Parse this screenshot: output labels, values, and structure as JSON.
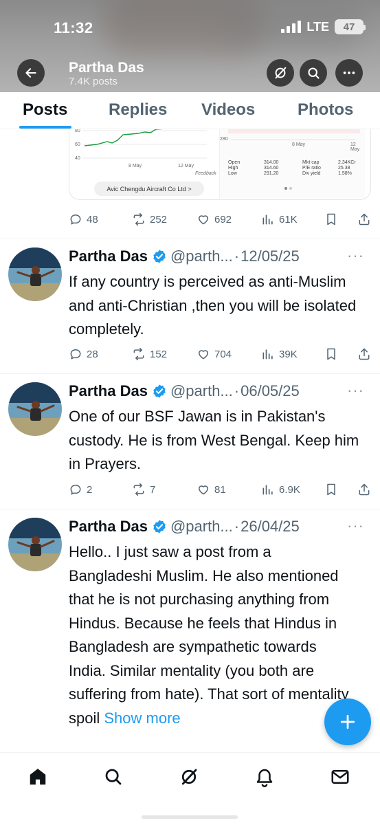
{
  "status_bar": {
    "time": "11:32",
    "network": "LTE",
    "battery": "47"
  },
  "profile": {
    "name": "Partha Das",
    "posts_count": "7.4K posts"
  },
  "tabs": [
    {
      "label": "Posts",
      "active": true
    },
    {
      "label": "Replies",
      "active": false
    },
    {
      "label": "Videos",
      "active": false
    },
    {
      "label": "Photos",
      "active": false
    }
  ],
  "embedded_card": {
    "ticker_label": "Avic Chengdu Aircraft Co Ltd  >",
    "chart_ticks": [
      "80",
      "60",
      "40"
    ],
    "chart_dates": [
      "8 May",
      "12 May"
    ],
    "feedback": "Feedback",
    "right_ticks": [
      "280"
    ],
    "right_dates": [
      "8 May",
      "12 May"
    ],
    "stats": [
      [
        "Open",
        "314.00",
        "Mkt cap",
        "2.34KCr"
      ],
      [
        "High",
        "314.60",
        "P/E ratio",
        "25.38"
      ],
      [
        "Low",
        "291.20",
        "Div yield",
        "1.58%"
      ]
    ]
  },
  "first_post_actions": {
    "replies": "48",
    "reposts": "252",
    "likes": "692",
    "views": "61K"
  },
  "tweets": [
    {
      "name": "Partha Das",
      "handle": "@parth...",
      "date": "12/05/25",
      "text": "If any country is perceived as anti-Muslim and anti-Christian ,then you will be isolated completely.",
      "replies": "28",
      "reposts": "152",
      "likes": "704",
      "views": "39K"
    },
    {
      "name": "Partha Das",
      "handle": "@parth...",
      "date": "06/05/25",
      "text": "One of our BSF Jawan is in Pakistan's custody. He is from West Bengal. Keep him in Prayers.",
      "replies": "2",
      "reposts": "7",
      "likes": "81",
      "views": "6.9K"
    },
    {
      "name": "Partha Das",
      "handle": "@parth...",
      "date": "26/04/25",
      "text": "Hello.. I just saw a post from a Bangladeshi Muslim. He also mentioned that he is not purchasing anything from Hindus. Because he feels that Hindus in Bangladesh are sympathetic towards India. Similar mentality (you both are suffering from hate). That sort of mentality spoil",
      "show_more": "Show more"
    }
  ],
  "icons": [
    "back-arrow-icon",
    "grok-icon",
    "search-icon",
    "more-icon",
    "verified-badge-icon",
    "reply-icon",
    "repost-icon",
    "like-icon",
    "views-icon",
    "bookmark-icon",
    "share-icon",
    "compose-icon",
    "home-icon",
    "notifications-icon",
    "messages-icon"
  ],
  "colors": {
    "accent": "#1d9bf0",
    "text": "#0f1419",
    "muted": "#536471"
  }
}
